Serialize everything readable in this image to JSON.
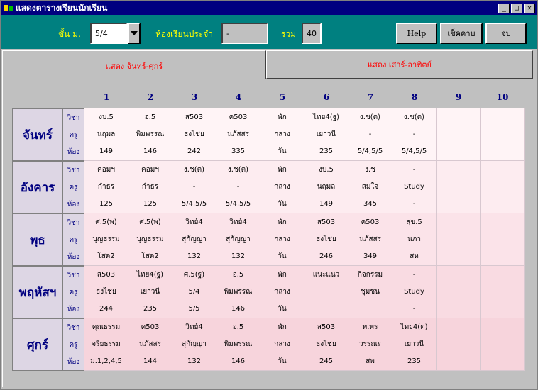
{
  "window": {
    "title": "แสดงตารางเรียนนักเรียน"
  },
  "toolbar": {
    "class_label": "ชั้น ม.",
    "class_value": "5/4",
    "homeroom_label": "ห้องเรียนประจำ",
    "homeroom_value": "-",
    "total_label": "รวม",
    "total_value": "40",
    "help_label": "Help",
    "check_label": "เช็คคาบ",
    "end_label": "จบ"
  },
  "tabs": [
    {
      "label": "แสดง จันทร์-ศุกร์",
      "active": true
    },
    {
      "label": "แสดง เสาร์-อาทิตย์",
      "active": false
    }
  ],
  "periods": [
    "1",
    "2",
    "3",
    "4",
    "5",
    "6",
    "7",
    "8",
    "9",
    "10"
  ],
  "row_labels": [
    "วิชา",
    "ครู",
    "ห้อง"
  ],
  "days": [
    {
      "name": "จันทร์",
      "shade": "#fff4f6",
      "cells": [
        [
          "งบ.5",
          "นฤมล",
          "149"
        ],
        [
          "อ.5",
          "พิมพรรณ",
          "146"
        ],
        [
          "ส503",
          "ธงไชย",
          "242"
        ],
        [
          "ค503",
          "นภัสสร",
          "335"
        ],
        [
          "พัก",
          "กลาง",
          "วัน"
        ],
        [
          "ไทย4(ฐ)",
          "เยาวนี",
          "235"
        ],
        [
          "ง.ช(ต)",
          "-",
          "5/4,5/5"
        ],
        [
          "ง.ช(ต)",
          "-",
          "5/4,5/5"
        ],
        [
          "",
          "",
          ""
        ],
        [
          "",
          "",
          ""
        ]
      ]
    },
    {
      "name": "อังคาร",
      "shade": "#fdecf0",
      "cells": [
        [
          "คอมฯ",
          "กำธร",
          "125"
        ],
        [
          "คอมฯ",
          "กำธร",
          "125"
        ],
        [
          "ง.ช(ต)",
          "-",
          "5/4,5/5"
        ],
        [
          "ง.ช(ต)",
          "-",
          "5/4,5/5"
        ],
        [
          "พัก",
          "กลาง",
          "วัน"
        ],
        [
          "งบ.5",
          "นฤมล",
          "149"
        ],
        [
          "ง.ช",
          "สมใจ",
          "345"
        ],
        [
          "-",
          "Study",
          "-"
        ],
        [
          "",
          "",
          ""
        ],
        [
          "",
          "",
          ""
        ]
      ]
    },
    {
      "name": "พุธ",
      "shade": "#fbe3e9",
      "cells": [
        [
          "ศ.5(พ)",
          "บุญธรรม",
          "โสต2"
        ],
        [
          "ศ.5(พ)",
          "บุญธรรม",
          "โสต2"
        ],
        [
          "วิทย์4",
          "สุกัญญา",
          "132"
        ],
        [
          "วิทย์4",
          "สุกัญญา",
          "132"
        ],
        [
          "พัก",
          "กลาง",
          "วัน"
        ],
        [
          "ส503",
          "ธงไชย",
          "246"
        ],
        [
          "ค503",
          "นภัสสร",
          "349"
        ],
        [
          "สุข.5",
          "นภา",
          "สห"
        ],
        [
          "",
          "",
          ""
        ],
        [
          "",
          "",
          ""
        ]
      ]
    },
    {
      "name": "พฤหัสฯ",
      "shade": "#f9dbe2",
      "cells": [
        [
          "ส503",
          "ธงไชย",
          "244"
        ],
        [
          "ไทย4(ฐ)",
          "เยาวนี",
          "235"
        ],
        [
          "ศ.5(ฐ)",
          "5/4",
          "5/5"
        ],
        [
          "อ.5",
          "พิมพรรณ",
          "146"
        ],
        [
          "พัก",
          "กลาง",
          "วัน"
        ],
        [
          "แนะแนว",
          "",
          ""
        ],
        [
          "กิจกรรม",
          "ชุมชน",
          ""
        ],
        [
          "-",
          "Study",
          "-"
        ],
        [
          "",
          "",
          ""
        ],
        [
          "",
          "",
          ""
        ]
      ]
    },
    {
      "name": "ศุกร์",
      "shade": "#f7d4dc",
      "cells": [
        [
          "คุณธรรม",
          "จริยธรรม",
          "ม.1,2,4,5"
        ],
        [
          "ค503",
          "นภัสสร",
          "144"
        ],
        [
          "วิทย์4",
          "สุกัญญา",
          "132"
        ],
        [
          "อ.5",
          "พิมพรรณ",
          "146"
        ],
        [
          "พัก",
          "กลาง",
          "วัน"
        ],
        [
          "ส503",
          "ธงไชย",
          "245"
        ],
        [
          "พ.พร",
          "วรรณะ",
          "สพ"
        ],
        [
          "ไทย4(ต)",
          "เยาวนี",
          "235"
        ],
        [
          "",
          "",
          ""
        ],
        [
          "",
          "",
          ""
        ]
      ]
    }
  ]
}
